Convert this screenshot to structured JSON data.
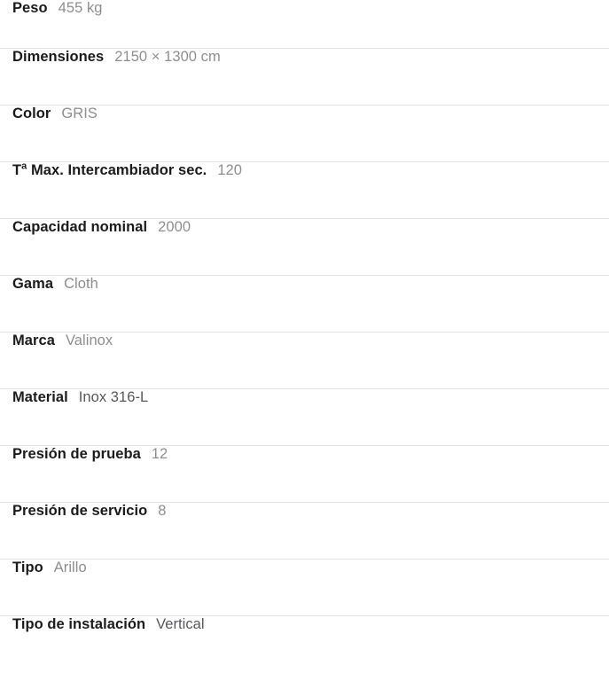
{
  "spec_table": {
    "rows": [
      {
        "label": "Peso",
        "value": "455 kg",
        "value_tone": "light"
      },
      {
        "label": "Dimensiones",
        "value": "2150 × 1300 cm",
        "value_tone": "light"
      },
      {
        "label": "Color",
        "value": "GRIS",
        "value_tone": "light"
      },
      {
        "label": "Tª Max. Intercambiador sec.",
        "value": "120",
        "value_tone": "light"
      },
      {
        "label": "Capacidad nominal",
        "value": "2000",
        "value_tone": "light"
      },
      {
        "label": "Gama",
        "value": "Cloth",
        "value_tone": "light"
      },
      {
        "label": "Marca",
        "value": "Valinox",
        "value_tone": "light"
      },
      {
        "label": "Material",
        "value": "Inox 316-L",
        "value_tone": "dark"
      },
      {
        "label": "Presión de prueba",
        "value": "12",
        "value_tone": "light"
      },
      {
        "label": "Presión de servicio",
        "value": "8",
        "value_tone": "light"
      },
      {
        "label": "Tipo",
        "value": "Arillo",
        "value_tone": "light"
      },
      {
        "label": "Tipo de instalación",
        "value": "Vertical",
        "value_tone": "dark"
      }
    ]
  },
  "colors": {
    "background": "#ffffff",
    "label_text": "#1b1b1b",
    "value_text": "#8e8e8e",
    "value_text_dark": "#55585c",
    "divider": "#e6e6e6"
  }
}
